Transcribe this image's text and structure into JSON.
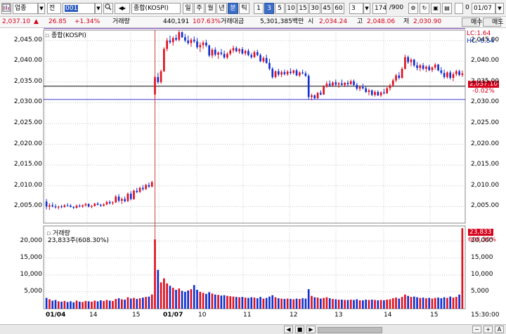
{
  "toolbar": {
    "market_label": "업종",
    "type_label": "전",
    "code_value": "001",
    "name_value": "종합(KOSPI)",
    "periods": [
      "일",
      "주",
      "월",
      "년",
      "분",
      "틱"
    ],
    "selected_period": "분",
    "intervals": [
      "1",
      "3",
      "5",
      "10",
      "15",
      "30",
      "45",
      "60"
    ],
    "selected_interval": "3",
    "interval_select_value": "3",
    "count_value": "174",
    "count_total": "/900",
    "date_value": "01/07",
    "checkbox_label": "0"
  },
  "quote": {
    "price": "2,037.10",
    "change_arrow": "▲",
    "change": "26.85",
    "change_rate": "+1.34%",
    "volume_label": "거래량",
    "volume": "440,191",
    "volume_rate": "107.63%",
    "amount_label": "거래대금",
    "amount": "5,301,385백만",
    "open_label": "시",
    "open": "2,034.24",
    "high_label": "고",
    "high": "2,048.06",
    "low_label": "저",
    "low": "2,030.90",
    "buy_label": "매수",
    "sell_label": "매도"
  },
  "price_panel": {
    "title": "종합(KOSPI)",
    "lc_label": "LC:1.64",
    "hc_label": "HC:-0.54",
    "last_price_label": "2,037.10",
    "last_change_label": "-0.02%",
    "y_ticks": [
      "2,045.00",
      "2,040.00",
      "2,035.00",
      "2,030.00",
      "2,025.00",
      "2,020.00",
      "2,015.00",
      "2,010.00",
      "2,005.00"
    ]
  },
  "volume_panel": {
    "title": "거래량",
    "summary": "23,833주(608.30%)",
    "last_volume_label": "23,833",
    "last_rate_label": "608.30%",
    "y_ticks": [
      "20,000",
      "15,000",
      "10,000",
      "5,000"
    ]
  },
  "x_axis": {
    "labels": [
      "01/04",
      "14",
      "15",
      "01/07",
      "10",
      "11",
      "12",
      "13",
      "14",
      "15"
    ],
    "time_label": "15:30:00"
  },
  "bottom_bar": {
    "scroll_buttons": [
      "◀",
      "■",
      "▶"
    ],
    "zoom_buttons": [
      "−",
      "+",
      "A"
    ]
  },
  "chart_data": {
    "type": "candlestick",
    "price_range": [
      2001,
      2047.5
    ],
    "volume_range": [
      0,
      24500
    ],
    "h_lines": [
      2047.9,
      2034.0,
      2030.8
    ],
    "vertical_marker_index": 36,
    "candles": [
      [
        2006.2,
        2006.8,
        2004.3,
        2005.0,
        3200
      ],
      [
        2005.0,
        2005.8,
        2004.2,
        2005.3,
        2800
      ],
      [
        2005.3,
        2006.0,
        2004.8,
        2005.0,
        2400
      ],
      [
        2005.0,
        2005.6,
        2004.5,
        2004.8,
        2600
      ],
      [
        2004.8,
        2005.2,
        2004.3,
        2005.0,
        2200
      ],
      [
        2005.0,
        2005.4,
        2004.6,
        2004.9,
        2100
      ],
      [
        2004.9,
        2005.6,
        2004.7,
        2005.3,
        2300
      ],
      [
        2005.3,
        2005.8,
        2005.0,
        2005.2,
        2000
      ],
      [
        2005.2,
        2005.6,
        2004.8,
        2004.9,
        2200
      ],
      [
        2004.9,
        2005.1,
        2004.4,
        2004.7,
        1900
      ],
      [
        2004.7,
        2005.5,
        2004.5,
        2005.2,
        2400
      ],
      [
        2005.2,
        2005.6,
        2004.8,
        2005.0,
        2100
      ],
      [
        2005.0,
        2005.5,
        2004.7,
        2005.3,
        2000
      ],
      [
        2005.3,
        2005.9,
        2005.0,
        2005.6,
        2300
      ],
      [
        2005.6,
        2005.8,
        2004.8,
        2005.0,
        2200
      ],
      [
        2005.0,
        2005.4,
        2004.6,
        2005.1,
        2100
      ],
      [
        2005.1,
        2005.9,
        2005.0,
        2005.7,
        2400
      ],
      [
        2005.7,
        2006.1,
        2005.3,
        2005.4,
        2200
      ],
      [
        2005.4,
        2005.7,
        2004.9,
        2005.2,
        2500
      ],
      [
        2005.2,
        2005.8,
        2005.0,
        2005.5,
        2300
      ],
      [
        2005.5,
        2006.4,
        2005.3,
        2006.1,
        2600
      ],
      [
        2006.1,
        2006.5,
        2005.5,
        2005.8,
        2400
      ],
      [
        2005.8,
        2006.3,
        2005.4,
        2006.0,
        2300
      ],
      [
        2006.0,
        2007.8,
        2005.9,
        2007.4,
        2900
      ],
      [
        2007.4,
        2008.0,
        2006.0,
        2006.4,
        3100
      ],
      [
        2006.4,
        2007.2,
        2005.6,
        2006.8,
        2800
      ],
      [
        2006.8,
        2007.4,
        2006.0,
        2006.3,
        2700
      ],
      [
        2006.3,
        2008.4,
        2006.1,
        2008.1,
        3400
      ],
      [
        2008.1,
        2008.7,
        2006.5,
        2006.8,
        3000
      ],
      [
        2006.8,
        2009.1,
        2006.6,
        2008.8,
        3200
      ],
      [
        2008.8,
        2009.5,
        2008.2,
        2008.5,
        2900
      ],
      [
        2008.5,
        2009.8,
        2008.3,
        2009.5,
        3100
      ],
      [
        2009.5,
        2010.2,
        2008.8,
        2009.2,
        3300
      ],
      [
        2009.2,
        2010.5,
        2009.0,
        2010.2,
        3500
      ],
      [
        2010.2,
        2010.8,
        2009.5,
        2009.8,
        3600
      ],
      [
        2009.8,
        2011.2,
        2009.6,
        2010.9,
        4200
      ],
      [
        2032.0,
        2036.6,
        2030.9,
        2036.2,
        20500
      ],
      [
        2036.2,
        2037.2,
        2034.6,
        2035.0,
        11500
      ],
      [
        2035.0,
        2038.0,
        2034.6,
        2037.6,
        7800
      ],
      [
        2037.6,
        2043.4,
        2037.4,
        2043.0,
        9000
      ],
      [
        2043.0,
        2045.6,
        2042.4,
        2045.0,
        7500
      ],
      [
        2045.0,
        2046.2,
        2044.2,
        2044.6,
        6800
      ],
      [
        2044.6,
        2046.0,
        2043.8,
        2045.6,
        6200
      ],
      [
        2045.6,
        2046.4,
        2044.9,
        2045.2,
        5600
      ],
      [
        2045.2,
        2047.5,
        2044.8,
        2047.0,
        6000
      ],
      [
        2047.0,
        2047.2,
        2045.6,
        2045.8,
        5300
      ],
      [
        2045.8,
        2046.6,
        2044.6,
        2045.0,
        5000
      ],
      [
        2045.0,
        2046.2,
        2044.0,
        2044.4,
        5400
      ],
      [
        2044.4,
        2045.6,
        2043.5,
        2045.2,
        5800
      ],
      [
        2045.2,
        2046.0,
        2044.4,
        2044.8,
        7000
      ],
      [
        2044.8,
        2045.6,
        2043.0,
        2043.4,
        5600
      ],
      [
        2043.4,
        2044.6,
        2042.2,
        2043.9,
        5000
      ],
      [
        2043.9,
        2045.0,
        2043.0,
        2044.5,
        4700
      ],
      [
        2044.5,
        2045.2,
        2043.4,
        2043.8,
        4400
      ],
      [
        2043.8,
        2044.0,
        2041.0,
        2041.4,
        4900
      ],
      [
        2041.4,
        2043.2,
        2040.8,
        2042.8,
        4500
      ],
      [
        2042.8,
        2043.4,
        2041.2,
        2041.6,
        4200
      ],
      [
        2041.6,
        2042.4,
        2040.6,
        2042.1,
        4100
      ],
      [
        2042.1,
        2043.0,
        2041.4,
        2041.8,
        3900
      ],
      [
        2041.8,
        2042.6,
        2040.6,
        2040.9,
        4000
      ],
      [
        2040.9,
        2042.2,
        2040.5,
        2041.8,
        3800
      ],
      [
        2041.8,
        2043.0,
        2041.4,
        2042.6,
        3700
      ],
      [
        2042.6,
        2043.8,
        2042.0,
        2043.2,
        3600
      ],
      [
        2043.2,
        2043.6,
        2042.2,
        2042.4,
        3500
      ],
      [
        2042.4,
        2043.2,
        2041.8,
        2042.9,
        3400
      ],
      [
        2042.9,
        2043.4,
        2041.6,
        2041.9,
        3500
      ],
      [
        2041.9,
        2042.8,
        2041.4,
        2042.5,
        3300
      ],
      [
        2042.5,
        2043.0,
        2041.2,
        2041.5,
        3200
      ],
      [
        2041.5,
        2042.0,
        2040.6,
        2041.0,
        3400
      ],
      [
        2041.0,
        2042.6,
        2040.8,
        2042.2,
        3300
      ],
      [
        2042.2,
        2042.8,
        2041.2,
        2041.5,
        3100
      ],
      [
        2041.5,
        2041.9,
        2039.8,
        2040.0,
        3500
      ],
      [
        2040.0,
        2041.2,
        2039.6,
        2040.8,
        3000
      ],
      [
        2040.8,
        2041.6,
        2039.4,
        2039.6,
        3200
      ],
      [
        2039.6,
        2040.6,
        2037.8,
        2038.2,
        3600
      ],
      [
        2038.2,
        2038.6,
        2035.8,
        2036.2,
        4000
      ],
      [
        2036.2,
        2037.8,
        2035.9,
        2037.6,
        3400
      ],
      [
        2037.6,
        2038.2,
        2036.4,
        2036.8,
        3100
      ],
      [
        2036.8,
        2037.8,
        2036.2,
        2037.4,
        3000
      ],
      [
        2037.4,
        2038.0,
        2036.6,
        2036.9,
        2900
      ],
      [
        2036.9,
        2037.9,
        2036.5,
        2037.5,
        3000
      ],
      [
        2037.5,
        2038.3,
        2036.8,
        2037.2,
        2900
      ],
      [
        2037.2,
        2038.0,
        2036.8,
        2037.8,
        2800
      ],
      [
        2037.8,
        2038.2,
        2036.4,
        2036.6,
        3000
      ],
      [
        2036.6,
        2037.6,
        2036.2,
        2037.3,
        2900
      ],
      [
        2037.3,
        2038.0,
        2036.8,
        2037.1,
        3100
      ],
      [
        2037.1,
        2037.6,
        2036.2,
        2036.5,
        3000
      ],
      [
        2036.5,
        2036.9,
        2030.8,
        2031.4,
        5800
      ],
      [
        2031.4,
        2032.2,
        2030.6,
        2031.8,
        3800
      ],
      [
        2031.8,
        2032.0,
        2030.8,
        2031.1,
        3400
      ],
      [
        2031.1,
        2032.6,
        2030.9,
        2032.4,
        3300
      ],
      [
        2032.4,
        2033.0,
        2031.8,
        2032.0,
        3000
      ],
      [
        2032.0,
        2034.2,
        2031.9,
        2033.9,
        3200
      ],
      [
        2033.9,
        2035.2,
        2033.6,
        2034.6,
        3400
      ],
      [
        2034.6,
        2035.4,
        2033.8,
        2034.2,
        3100
      ],
      [
        2034.2,
        2035.2,
        2033.8,
        2034.9,
        2900
      ],
      [
        2034.9,
        2035.6,
        2034.0,
        2034.4,
        2800
      ],
      [
        2034.4,
        2035.0,
        2033.6,
        2034.7,
        2700
      ],
      [
        2034.7,
        2035.6,
        2034.2,
        2034.3,
        2700
      ],
      [
        2034.3,
        2035.0,
        2033.8,
        2034.8,
        2600
      ],
      [
        2034.8,
        2035.4,
        2034.0,
        2034.5,
        2600
      ],
      [
        2034.5,
        2035.6,
        2034.3,
        2035.2,
        2700
      ],
      [
        2035.2,
        2035.6,
        2034.0,
        2034.3,
        2600
      ],
      [
        2034.3,
        2034.8,
        2033.0,
        2033.4,
        2800
      ],
      [
        2033.4,
        2034.2,
        2032.8,
        2033.8,
        2500
      ],
      [
        2033.8,
        2034.6,
        2033.2,
        2033.5,
        2500
      ],
      [
        2033.5,
        2034.0,
        2032.4,
        2032.6,
        2700
      ],
      [
        2032.6,
        2033.4,
        2031.8,
        2033.0,
        2600
      ],
      [
        2033.0,
        2033.2,
        2031.6,
        2031.9,
        2700
      ],
      [
        2031.9,
        2033.0,
        2031.5,
        2032.6,
        2600
      ],
      [
        2032.6,
        2033.0,
        2031.6,
        2031.8,
        2500
      ],
      [
        2031.8,
        2032.8,
        2031.4,
        2032.5,
        2600
      ],
      [
        2032.5,
        2033.4,
        2032.0,
        2032.3,
        2500
      ],
      [
        2032.3,
        2033.8,
        2032.1,
        2033.5,
        2700
      ],
      [
        2033.5,
        2034.6,
        2032.9,
        2034.2,
        2800
      ],
      [
        2034.2,
        2035.8,
        2033.8,
        2035.4,
        3100
      ],
      [
        2035.4,
        2037.0,
        2035.0,
        2036.6,
        3300
      ],
      [
        2036.6,
        2037.4,
        2035.6,
        2036.0,
        3000
      ],
      [
        2036.0,
        2038.6,
        2035.8,
        2038.2,
        3500
      ],
      [
        2038.2,
        2041.6,
        2038.0,
        2041.0,
        4200
      ],
      [
        2041.0,
        2041.4,
        2039.4,
        2039.8,
        3800
      ],
      [
        2039.8,
        2040.8,
        2038.8,
        2040.4,
        3500
      ],
      [
        2040.4,
        2040.6,
        2038.6,
        2039.0,
        3600
      ],
      [
        2039.0,
        2039.8,
        2037.8,
        2038.4,
        3400
      ],
      [
        2038.4,
        2039.4,
        2037.6,
        2039.0,
        3200
      ],
      [
        2039.0,
        2039.6,
        2037.8,
        2038.2,
        3300
      ],
      [
        2038.2,
        2039.0,
        2037.4,
        2038.7,
        3100
      ],
      [
        2038.7,
        2039.2,
        2037.6,
        2037.9,
        3200
      ],
      [
        2037.9,
        2038.8,
        2037.4,
        2038.5,
        3000
      ],
      [
        2038.5,
        2039.6,
        2038.0,
        2039.2,
        3200
      ],
      [
        2039.2,
        2039.4,
        2037.6,
        2037.8,
        3300
      ],
      [
        2037.8,
        2038.6,
        2036.8,
        2037.2,
        3100
      ],
      [
        2037.2,
        2038.0,
        2035.8,
        2036.2,
        3400
      ],
      [
        2036.2,
        2037.6,
        2035.8,
        2037.3,
        3200
      ],
      [
        2037.3,
        2037.8,
        2035.6,
        2036.0,
        3600
      ],
      [
        2036.0,
        2037.4,
        2035.2,
        2036.9,
        3300
      ],
      [
        2036.9,
        2038.0,
        2036.4,
        2037.6,
        3500
      ],
      [
        2037.6,
        2038.0,
        2036.4,
        2036.7,
        4200
      ],
      [
        2036.7,
        2037.8,
        2036.2,
        2037.1,
        23833
      ]
    ]
  }
}
